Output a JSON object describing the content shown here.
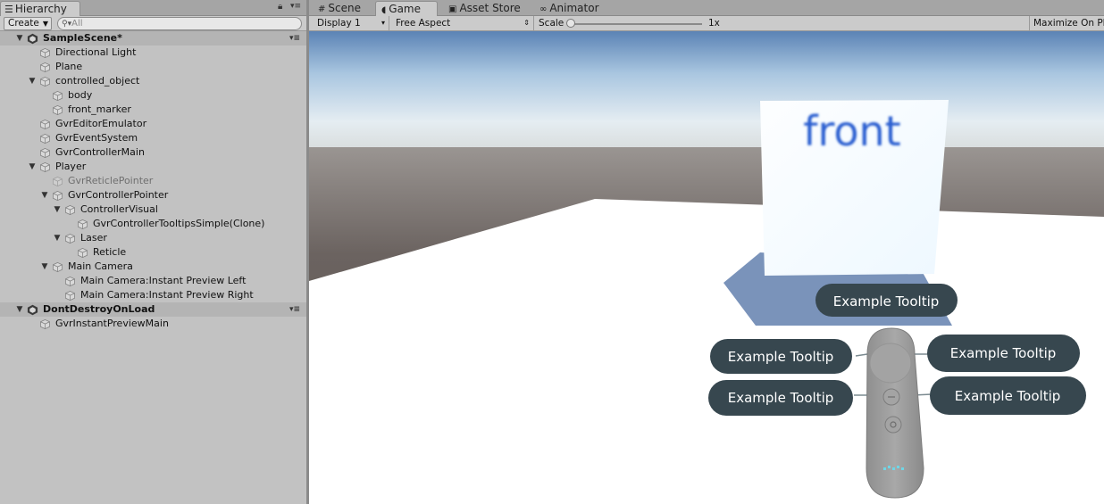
{
  "hierarchy": {
    "tab_label": "Hierarchy",
    "create_label": "Create",
    "search_placeholder": "All",
    "items": [
      {
        "label": "SampleScene*",
        "type": "scene",
        "depth": 0,
        "fold": "open"
      },
      {
        "label": "Directional Light",
        "depth": 1,
        "fold": "none"
      },
      {
        "label": "Plane",
        "depth": 1,
        "fold": "none"
      },
      {
        "label": "controlled_object",
        "depth": 1,
        "fold": "open"
      },
      {
        "label": "body",
        "depth": 2,
        "fold": "none"
      },
      {
        "label": "front_marker",
        "depth": 2,
        "fold": "none"
      },
      {
        "label": "GvrEditorEmulator",
        "depth": 1,
        "fold": "none"
      },
      {
        "label": "GvrEventSystem",
        "depth": 1,
        "fold": "none"
      },
      {
        "label": "GvrControllerMain",
        "depth": 1,
        "fold": "none"
      },
      {
        "label": "Player",
        "depth": 1,
        "fold": "open"
      },
      {
        "label": "GvrReticlePointer",
        "depth": 2,
        "fold": "none",
        "inactive": true
      },
      {
        "label": "GvrControllerPointer",
        "depth": 2,
        "fold": "open"
      },
      {
        "label": "ControllerVisual",
        "depth": 3,
        "fold": "open"
      },
      {
        "label": "GvrControllerTooltipsSimple(Clone)",
        "depth": 4,
        "fold": "none"
      },
      {
        "label": "Laser",
        "depth": 3,
        "fold": "open"
      },
      {
        "label": "Reticle",
        "depth": 4,
        "fold": "none"
      },
      {
        "label": "Main Camera",
        "depth": 2,
        "fold": "open"
      },
      {
        "label": "Main Camera:Instant Preview Left",
        "depth": 3,
        "fold": "none"
      },
      {
        "label": "Main Camera:Instant Preview Right",
        "depth": 3,
        "fold": "none"
      },
      {
        "label": "DontDestroyOnLoad",
        "type": "scene",
        "depth": 0,
        "fold": "open"
      },
      {
        "label": "GvrInstantPreviewMain",
        "depth": 1,
        "fold": "none"
      }
    ]
  },
  "tabs": [
    {
      "label": "Scene",
      "icon": "scene-grid-icon",
      "active": false
    },
    {
      "label": "Game",
      "icon": "game-pacman-icon",
      "active": true
    },
    {
      "label": "Asset Store",
      "icon": "store-bag-icon",
      "active": false
    },
    {
      "label": "Animator",
      "icon": "animator-icon",
      "active": false
    }
  ],
  "game_toolbar": {
    "display": "Display 1",
    "aspect": "Free Aspect",
    "scale_label": "Scale",
    "scale_value": "1x",
    "scale_level": 0,
    "maximize_label": "Maximize On Play"
  },
  "viewport": {
    "front_text": "front",
    "tooltip_text": "Example Tooltip",
    "colors": {
      "sky_top": "#5b83b5",
      "horizon": "#e8eef2",
      "ground": "#5d5450",
      "plane": "#ffffff",
      "front_text": "#2c5ed0",
      "tooltip_bg": "#37474f",
      "controller": "#9e9e9e"
    }
  }
}
